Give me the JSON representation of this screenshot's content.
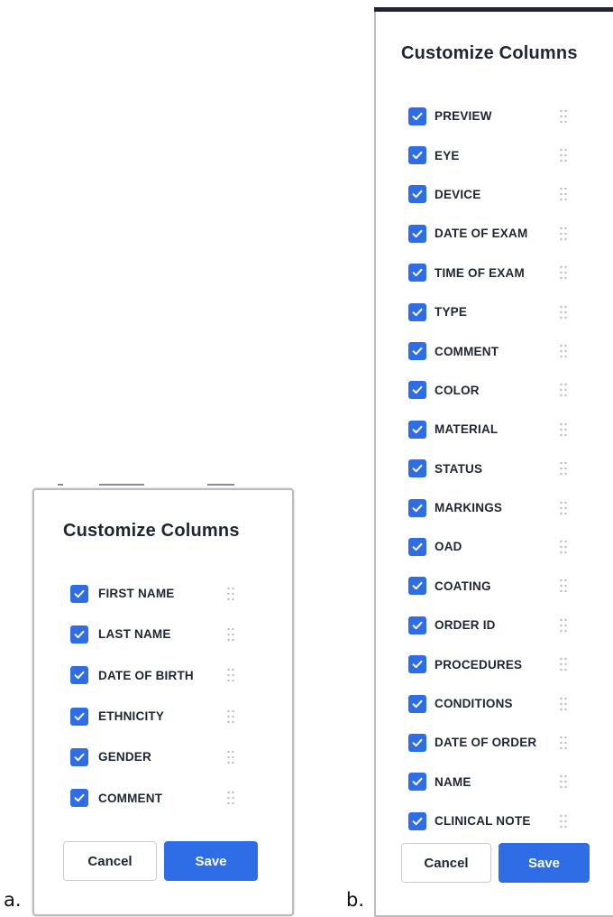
{
  "panel_a": {
    "label": "a.",
    "title": "Customize Columns",
    "columns": [
      {
        "label": "FIRST NAME",
        "checked": true
      },
      {
        "label": "LAST NAME",
        "checked": true
      },
      {
        "label": "DATE OF BIRTH",
        "checked": true
      },
      {
        "label": "ETHNICITY",
        "checked": true
      },
      {
        "label": "GENDER",
        "checked": true
      },
      {
        "label": "COMMENT",
        "checked": true
      }
    ],
    "cancel_label": "Cancel",
    "save_label": "Save"
  },
  "panel_b": {
    "label": "b.",
    "title": "Customize Columns",
    "columns": [
      {
        "label": "PREVIEW",
        "checked": true
      },
      {
        "label": "EYE",
        "checked": true
      },
      {
        "label": "DEVICE",
        "checked": true
      },
      {
        "label": "DATE OF EXAM",
        "checked": true
      },
      {
        "label": "TIME OF EXAM",
        "checked": true
      },
      {
        "label": "TYPE",
        "checked": true
      },
      {
        "label": "COMMENT",
        "checked": true
      },
      {
        "label": "COLOR",
        "checked": true
      },
      {
        "label": "MATERIAL",
        "checked": true
      },
      {
        "label": "STATUS",
        "checked": true
      },
      {
        "label": "MARKINGS",
        "checked": true
      },
      {
        "label": "OAD",
        "checked": true
      },
      {
        "label": "COATING",
        "checked": true
      },
      {
        "label": "ORDER ID",
        "checked": true
      },
      {
        "label": "PROCEDURES",
        "checked": true
      },
      {
        "label": "CONDITIONS",
        "checked": true
      },
      {
        "label": "DATE OF ORDER",
        "checked": true
      },
      {
        "label": "NAME",
        "checked": true
      },
      {
        "label": "CLINICAL NOTE",
        "checked": true
      }
    ],
    "cancel_label": "Cancel",
    "save_label": "Save"
  },
  "icons": {
    "checkbox": "check-icon",
    "drag": "drag-handle-icon"
  },
  "colors": {
    "accent": "#2f6de6",
    "text": "#1e2633",
    "handle": "#b8bcc2",
    "border": "#c8ccd2"
  }
}
